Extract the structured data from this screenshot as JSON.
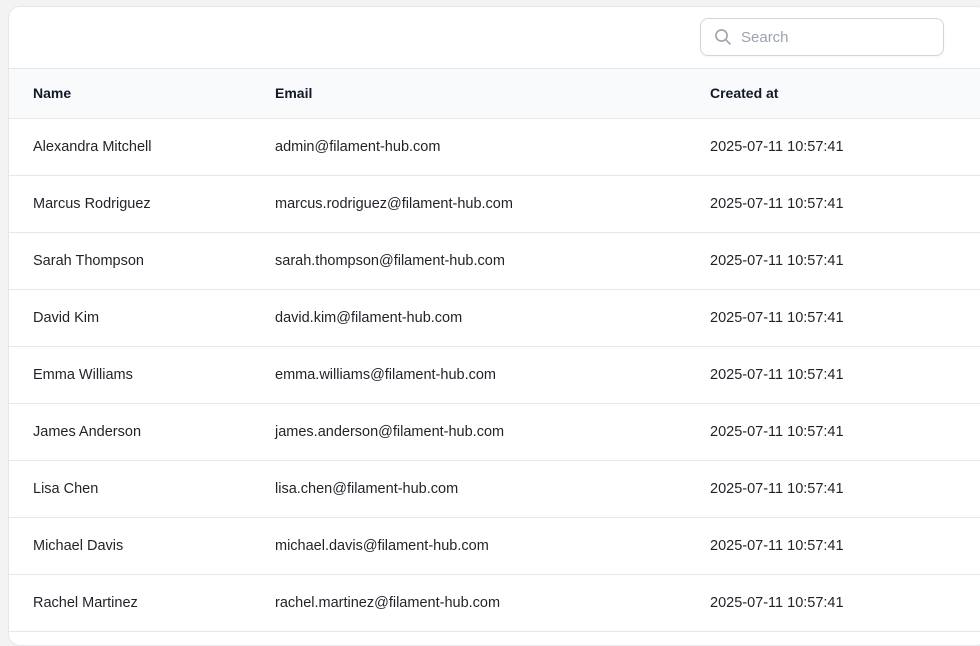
{
  "search": {
    "placeholder": "Search",
    "icon": "search-icon"
  },
  "table": {
    "columns": [
      "Name",
      "Email",
      "Created at"
    ],
    "rows": [
      {
        "name": "Alexandra Mitchell",
        "email": "admin@filament-hub.com",
        "created_at": "2025-07-11 10:57:41"
      },
      {
        "name": "Marcus Rodriguez",
        "email": "marcus.rodriguez@filament-hub.com",
        "created_at": "2025-07-11 10:57:41"
      },
      {
        "name": "Sarah Thompson",
        "email": "sarah.thompson@filament-hub.com",
        "created_at": "2025-07-11 10:57:41"
      },
      {
        "name": "David Kim",
        "email": "david.kim@filament-hub.com",
        "created_at": "2025-07-11 10:57:41"
      },
      {
        "name": "Emma Williams",
        "email": "emma.williams@filament-hub.com",
        "created_at": "2025-07-11 10:57:41"
      },
      {
        "name": "James Anderson",
        "email": "james.anderson@filament-hub.com",
        "created_at": "2025-07-11 10:57:41"
      },
      {
        "name": "Lisa Chen",
        "email": "lisa.chen@filament-hub.com",
        "created_at": "2025-07-11 10:57:41"
      },
      {
        "name": "Michael Davis",
        "email": "michael.davis@filament-hub.com",
        "created_at": "2025-07-11 10:57:41"
      },
      {
        "name": "Rachel Martinez",
        "email": "rachel.martinez@filament-hub.com",
        "created_at": "2025-07-11 10:57:41"
      }
    ]
  }
}
